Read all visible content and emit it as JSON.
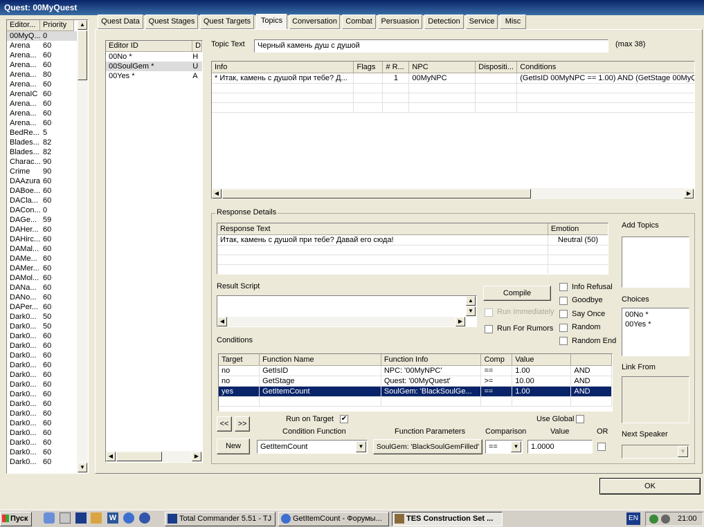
{
  "window": {
    "title": "Quest: 00MyQuest"
  },
  "quest_list": {
    "columns": [
      "Editor...",
      "Priority"
    ],
    "rows": [
      [
        "00MyQ...",
        "0"
      ],
      [
        "Arena",
        "60"
      ],
      [
        "Arena...",
        "60"
      ],
      [
        "Arena...",
        "60"
      ],
      [
        "Arena...",
        "80"
      ],
      [
        "Arena...",
        "60"
      ],
      [
        "ArenaIC",
        "60"
      ],
      [
        "Arena...",
        "60"
      ],
      [
        "Arena...",
        "60"
      ],
      [
        "Arena...",
        "60"
      ],
      [
        "BedRe...",
        "5"
      ],
      [
        "Blades...",
        "82"
      ],
      [
        "Blades...",
        "82"
      ],
      [
        "Charac...",
        "90"
      ],
      [
        "Crime",
        "90"
      ],
      [
        "DAAzura",
        "60"
      ],
      [
        "DABoe...",
        "60"
      ],
      [
        "DACla...",
        "60"
      ],
      [
        "DACon...",
        "0"
      ],
      [
        "DAGe...",
        "59"
      ],
      [
        "DAHer...",
        "60"
      ],
      [
        "DAHirc...",
        "60"
      ],
      [
        "DAMal...",
        "60"
      ],
      [
        "DAMe...",
        "60"
      ],
      [
        "DAMer...",
        "60"
      ],
      [
        "DAMol...",
        "60"
      ],
      [
        "DANa...",
        "60"
      ],
      [
        "DANo...",
        "60"
      ],
      [
        "DAPer...",
        "60"
      ],
      [
        "Dark0...",
        "50"
      ],
      [
        "Dark0...",
        "50"
      ],
      [
        "Dark0...",
        "60"
      ],
      [
        "Dark0...",
        "60"
      ],
      [
        "Dark0...",
        "60"
      ],
      [
        "Dark0...",
        "60"
      ],
      [
        "Dark0...",
        "60"
      ],
      [
        "Dark0...",
        "60"
      ],
      [
        "Dark0...",
        "60"
      ],
      [
        "Dark0...",
        "60"
      ],
      [
        "Dark0...",
        "60"
      ],
      [
        "Dark0...",
        "60"
      ],
      [
        "Dark0...",
        "60"
      ],
      [
        "Dark0...",
        "60"
      ],
      [
        "Dark0...",
        "60"
      ],
      [
        "Dark0...",
        "60"
      ]
    ]
  },
  "tabs": [
    "Quest Data",
    "Quest Stages",
    "Quest Targets",
    "Topics",
    "Conversation",
    "Combat",
    "Persuasion",
    "Detection",
    "Service",
    "Misc"
  ],
  "topics": {
    "column": "Editor ID",
    "column2": "D",
    "items": [
      "00No *",
      "00SoulGem *",
      "00Yes *"
    ],
    "col2_items": [
      "H",
      "U",
      "A"
    ]
  },
  "topic_text": {
    "label": "Topic Text",
    "value": "Черный камень душ с душой",
    "max": "(max 38)"
  },
  "info_table": {
    "columns": [
      "Info",
      "Flags",
      "# R...",
      "NPC",
      "Dispositi...",
      "Conditions"
    ],
    "rows": [
      [
        "* Итак, камень с душой при тебе? Д...",
        "",
        "1",
        "00MyNPC",
        "",
        "(GetIsID 00MyNPC == 1.00) AND (GetStage 00MyQ"
      ]
    ]
  },
  "response_details": {
    "label": "Response Details",
    "columns": [
      "Response Text",
      "Emotion"
    ],
    "rows": [
      [
        "Итак, камень с душой при тебе? Давай его сюда!",
        "Neutral (50)"
      ]
    ]
  },
  "result_script": {
    "label": "Result Script"
  },
  "buttons": {
    "compile": "Compile",
    "run_immediately": "Run Immediately",
    "run_for_rumors": "Run For Rumors",
    "prev": "<<",
    "next": ">>",
    "new": "New",
    "ok": "OK",
    "function_params": "SoulGem: 'BlackSoulGemFilled'"
  },
  "flags": {
    "info_refusal": "Info Refusal",
    "goodbye": "Goodbye",
    "say_once": "Say Once",
    "random": "Random",
    "random_end": "Random End"
  },
  "add_topics": {
    "label": "Add Topics"
  },
  "choices": {
    "label": "Choices",
    "items": [
      "00No *",
      "00Yes *"
    ]
  },
  "link_from": {
    "label": "Link From"
  },
  "next_speaker": {
    "label": "Next Speaker"
  },
  "conditions": {
    "label": "Conditions",
    "columns": [
      "Target",
      "Function Name",
      "Function Info",
      "Comp",
      "Value",
      ""
    ],
    "rows": [
      [
        "no",
        "GetIsID",
        "NPC: '00MyNPC'",
        "==",
        "1.00",
        "AND"
      ],
      [
        "no",
        "GetStage",
        "Quest: '00MyQuest'",
        ">=",
        "10.00",
        "AND"
      ],
      [
        "yes",
        "GetItemCount",
        "SoulGem: 'BlackSoulGe...",
        "==",
        "1.00",
        "AND"
      ]
    ],
    "selected_row": 2
  },
  "condition_editor": {
    "run_on_target": "Run on Target",
    "use_global": "Use Global",
    "condition_function_label": "Condition Function",
    "function_parameters_label": "Function Parameters",
    "comparison_label": "Comparison",
    "value_label": "Value",
    "or_label": "OR",
    "function_value": "GetItemCount",
    "comparison_value": "==",
    "value_value": "1.0000"
  },
  "taskbar": {
    "start": "Пуск",
    "tasks": [
      "Total Commander 5.51 - TJ",
      "GetItemCount - Форумы...",
      "TES Construction Set ..."
    ],
    "lang": "EN",
    "clock": "21:00"
  },
  "colors": {
    "title_start": "#0a246a",
    "title_end": "#3a6ea5",
    "selection": "#0a246a",
    "face": "#ece9d8"
  }
}
